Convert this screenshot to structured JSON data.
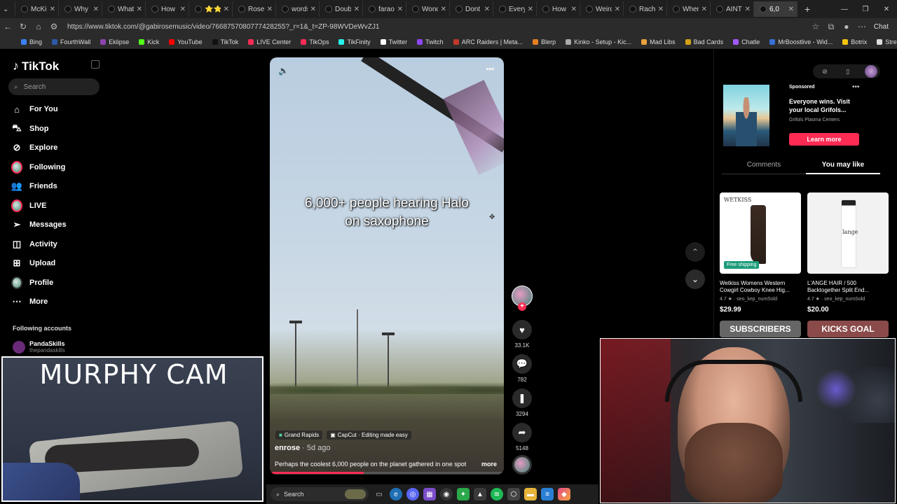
{
  "browser": {
    "tabs": [
      {
        "label": "McKinl"
      },
      {
        "label": "Why W"
      },
      {
        "label": "What H"
      },
      {
        "label": "How to"
      },
      {
        "label": "⭐⭐⭐"
      },
      {
        "label": "Roses A"
      },
      {
        "label": "words c"
      },
      {
        "label": "Double"
      },
      {
        "label": "faraoni"
      },
      {
        "label": "Wonde"
      },
      {
        "label": "Dont b"
      },
      {
        "label": "Everyth"
      },
      {
        "label": "How to"
      },
      {
        "label": "Weird C"
      },
      {
        "label": "Rachel F"
      },
      {
        "label": "When I"
      },
      {
        "label": "AINT N"
      },
      {
        "label": "6,0"
      }
    ],
    "url": "https://www.tiktok.com/@gabirosemusic/video/7668757080777428255?_r=1&_t=ZP-98WVDeWvZJ1",
    "chat_label": "Chat",
    "bookmarks": [
      "Bing",
      "FourthWall",
      "Eklipse",
      "Kick",
      "YouTube",
      "TikTok",
      "LIVE Center",
      "TikOps",
      "TikFinity",
      "Twitter",
      "Twitch",
      "ARC Raiders | Meta...",
      "Blerp",
      "Kinko - Setup - Kic...",
      "Mad Libs",
      "Bad Cards",
      "Chatle",
      "MrBoostlive - Wid...",
      "Botrix",
      "StreamElements"
    ]
  },
  "tiktok": {
    "logo": "TikTok",
    "search_placeholder": "Search",
    "nav": [
      "For You",
      "Shop",
      "Explore",
      "Following",
      "Friends",
      "LIVE",
      "Messages",
      "Activity",
      "Upload",
      "Profile",
      "More"
    ],
    "following_heading": "Following accounts",
    "following": [
      {
        "name": "PandaSkills",
        "handle": "thepandaskills"
      }
    ]
  },
  "video": {
    "caption_line1": "6,000+ people hearing Halo",
    "caption_line2": "on saxophone",
    "location": "Grand Rapids",
    "capcut": "CapCut · Editing made easy",
    "author": "enrose",
    "ago": " · 5d ago",
    "description": "Perhaps the coolest 6,000 people on the planet gathered in one spot",
    "more": "more",
    "progress": 0.4
  },
  "actions": {
    "likes": "33.1K",
    "comments": "782",
    "saves": "3294",
    "shares": "5148"
  },
  "ad": {
    "sponsored": "Sponsored",
    "title": "Everyone wins. Visit your local Grifols...",
    "subtitle": "Grifols Plasma Centers",
    "cta": "Learn more"
  },
  "right_tabs": {
    "comments": "Comments",
    "you_may_like": "You may like"
  },
  "products": [
    {
      "title": "Wetkiss Womens Western Cowgirl Cowboy Knee Hig...",
      "rating": "4.7 ★ · seo_kep_numSold",
      "price": "$29.99",
      "badge": "Free shipping",
      "brand": "WETKISS"
    },
    {
      "title": "L'ANGE HAIR / 500 Backtogether Split End...",
      "rating": "4.7 ★ · seo_kep_numSold",
      "price": "$20.00",
      "brand": "lange"
    }
  ],
  "cards_below": [
    "SUBSCRIBERS",
    "KICKS GOAL"
  ],
  "overlay": {
    "murphy_title": "MURPHY CAM"
  },
  "taskbar": {
    "search": "Search"
  }
}
